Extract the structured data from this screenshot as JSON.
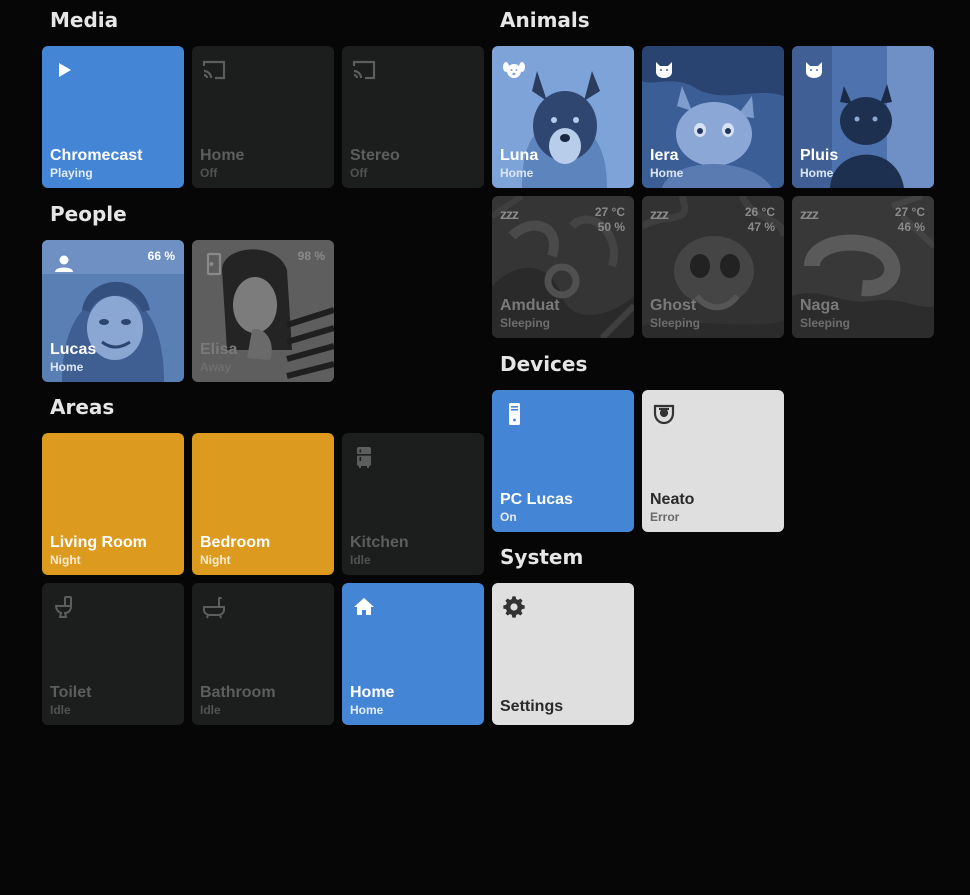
{
  "sections": {
    "media": "Media",
    "people": "People",
    "areas": "Areas",
    "animals": "Animals",
    "devices": "Devices",
    "system": "System"
  },
  "media": [
    {
      "name": "Chromecast",
      "state": "Playing",
      "icon": "play-icon"
    },
    {
      "name": "Home",
      "state": "Off",
      "icon": "cast-icon"
    },
    {
      "name": "Stereo",
      "state": "Off",
      "icon": "cast-icon"
    }
  ],
  "people": [
    {
      "name": "Lucas",
      "state": "Home",
      "battery": "66 %",
      "icon": "person-icon"
    },
    {
      "name": "Elisa",
      "state": "Away",
      "battery": "98 %",
      "icon": "door-icon"
    }
  ],
  "areas": [
    {
      "name": "Living Room",
      "state": "Night",
      "icon": "moon-icon"
    },
    {
      "name": "Bedroom",
      "state": "Night",
      "icon": "moon-icon"
    },
    {
      "name": "Kitchen",
      "state": "Idle",
      "icon": "fridge-icon"
    },
    {
      "name": "Toilet",
      "state": "Idle",
      "icon": "toilet-icon"
    },
    {
      "name": "Bathroom",
      "state": "Idle",
      "icon": "bathtub-icon"
    },
    {
      "name": "Home",
      "state": "Home",
      "icon": "home-icon"
    }
  ],
  "animals": [
    {
      "name": "Luna",
      "state": "Home",
      "icon": "dog-icon"
    },
    {
      "name": "Iera",
      "state": "Home",
      "icon": "cat-icon"
    },
    {
      "name": "Pluis",
      "state": "Home",
      "icon": "cat-icon"
    },
    {
      "name": "Amduat",
      "state": "Sleeping",
      "temp": "27 °C",
      "humidity": "50 %",
      "icon": "sleep-icon"
    },
    {
      "name": "Ghost",
      "state": "Sleeping",
      "temp": "26 °C",
      "humidity": "47 %",
      "icon": "sleep-icon"
    },
    {
      "name": "Naga",
      "state": "Sleeping",
      "temp": "27 °C",
      "humidity": "46 %",
      "icon": "sleep-icon"
    }
  ],
  "devices": [
    {
      "name": "PC Lucas",
      "state": "On",
      "icon": "desktop-tower-icon"
    },
    {
      "name": "Neato",
      "state": "Error",
      "icon": "robot-vacuum-icon"
    }
  ],
  "system": [
    {
      "name": "Settings",
      "icon": "gear-icon"
    }
  ],
  "zzz": "zzz",
  "colors": {
    "background": "#060606",
    "tile_dark": "#1c1d1d",
    "tile_blue": "#4485d6",
    "tile_orange": "#dc9b1f",
    "tile_light": "#dfdfdf"
  }
}
